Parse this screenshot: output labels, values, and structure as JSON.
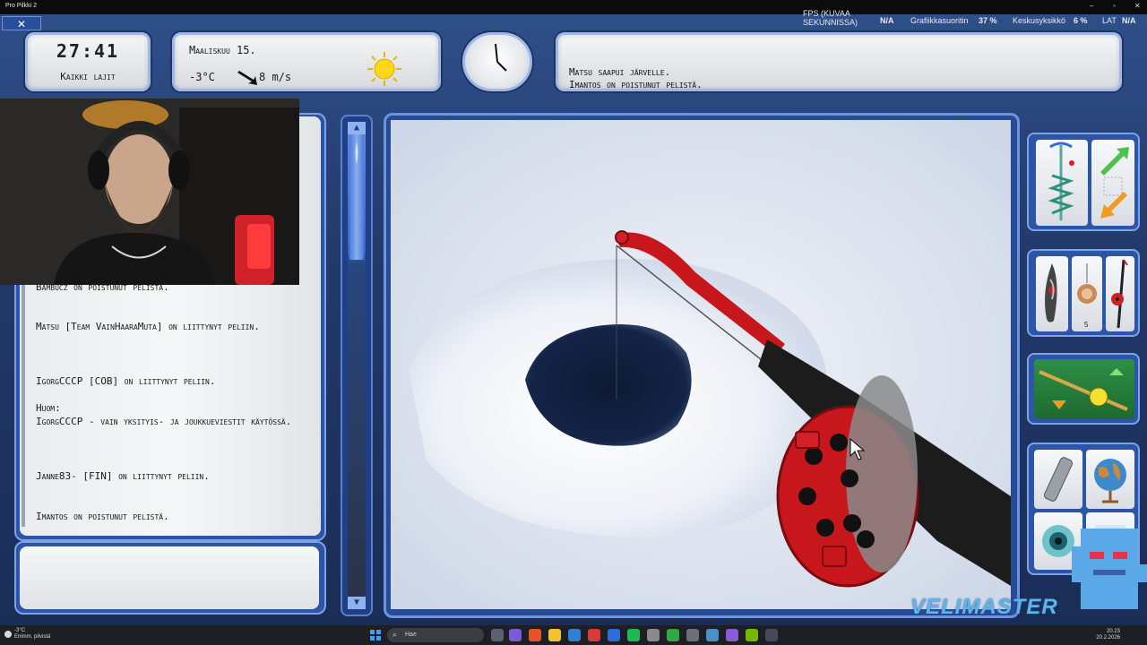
{
  "window": {
    "title": "Pro Pilkki 2",
    "close_label": "✕"
  },
  "overlay": {
    "fps_label": "FPS (KUVAA SEKUNNISSA)",
    "fps_value": "N/A",
    "gpu_label": "Grafiikkasuoritin",
    "gpu_value": "37 %",
    "cpu_label": "Keskusyksikkö",
    "cpu_value": "6 %",
    "lat_label": "LAT",
    "lat_value": "N/A"
  },
  "hud": {
    "time": "27:41",
    "mode": "Kaikki lajit",
    "date": "Maaliskuu 15.",
    "temperature": "-3°C",
    "wind": "8 m/s",
    "weather_icon": "sun-icon",
    "messages": [
      "Matsu saapui järvelle.",
      "Imantos on poistunut pelistä."
    ]
  },
  "chat": {
    "lines": [
      "Bambucz on poistunut pelistä.",
      "Matsu [Team VainHaaraMuta] on liittynyt peliin.",
      "IgorgCCCP [COB] on liittynyt peliin.",
      "Huom:",
      "IgorgCCCP - vain yksityis- ja joukkueviestit käytössä.",
      "Janne83- [FIN] on liittynyt peliin.",
      "Imantos on poistunut pelistä."
    ],
    "input_value": ""
  },
  "tools": {
    "groups": [
      {
        "name": "auger-and-move",
        "items": [
          "ice-auger-icon",
          "move-arrows-icon"
        ]
      },
      {
        "name": "lures",
        "items": [
          "lure-icon",
          "bait-icon",
          "rod-icon"
        ],
        "bait_count": "5"
      },
      {
        "name": "rod-selector",
        "items": [
          "rod-icon"
        ]
      },
      {
        "name": "misc",
        "items": [
          "flashlight-icon",
          "globe-icon",
          "eye-icon",
          "settings-icon"
        ]
      }
    ]
  },
  "watermark": "VELIMASTER",
  "taskbar": {
    "weather_temp": "-3°C",
    "weather_desc": "Enimm. pilvistä",
    "search_placeholder": "Hae",
    "time": "20.23",
    "date": "20.2.2026"
  },
  "colors": {
    "frame_blue": "#2c55a8",
    "rod_red": "#c8161d",
    "hole_dark": "#0c1a33"
  }
}
